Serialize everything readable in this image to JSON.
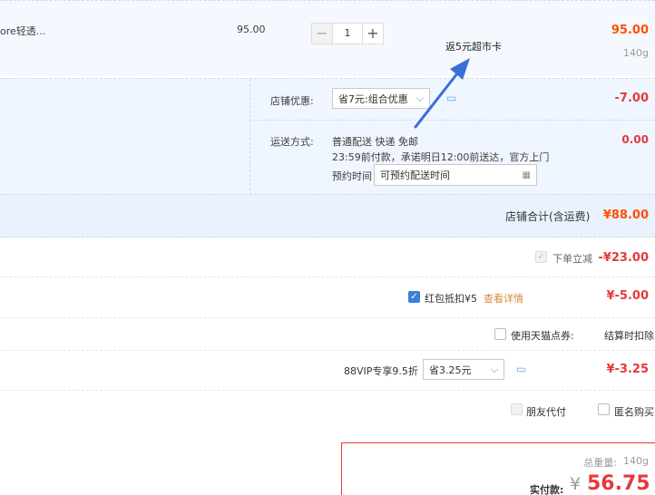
{
  "item": {
    "name_fragment": "ore轻透...",
    "unit_price": "95.00",
    "quantity": "1",
    "subtotal": "95.00",
    "weight": "140g"
  },
  "annotation": {
    "text": "返5元超市卡",
    "arrow_color": "#3a6fd8"
  },
  "shop": {
    "discount_label": "店铺优惠:",
    "discount_select": "省7元:组合优惠",
    "discount_amount": "-7.00",
    "shipping_label": "运送方式:",
    "shipping_line1": "普通配送 快递 免邮",
    "shipping_line2": "23:59前付款，承诺明日12:00前送达，官方上门",
    "reserve_label": "预约时间",
    "reserve_placeholder": "可预约配送时间",
    "shipping_amount": "0.00",
    "total_label": "店铺合计(含运费)",
    "total_amount": "¥88.00"
  },
  "order_discount": {
    "label": "下单立减",
    "amount": "-¥23.00"
  },
  "red_packet": {
    "label": "红包抵扣¥5",
    "link": "查看详情",
    "amount": "¥-5.00"
  },
  "tmall_points": {
    "label": "使用天猫点券:",
    "note": "结算时扣除"
  },
  "vip": {
    "label": "88VIP专享9.5折",
    "select": "省3.25元",
    "amount": "¥-3.25"
  },
  "pay_options": {
    "friend_pay": "朋友代付",
    "anonymous": "匿名购买"
  },
  "summary": {
    "weight_label": "总重量:",
    "weight": "140g",
    "pay_label": "实付款:",
    "currency": "¥",
    "amount": "56.75"
  },
  "colors": {
    "accent_red": "#e4393c",
    "accent_orange": "#ff5000",
    "accent_blue": "#3b82d6",
    "panel_bg": "#f0f6ff"
  }
}
